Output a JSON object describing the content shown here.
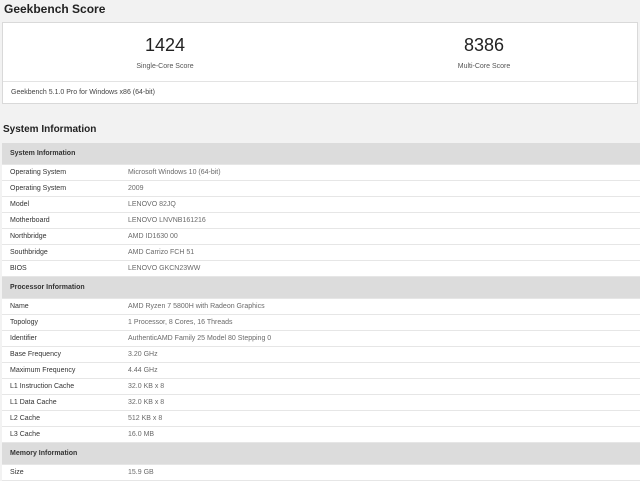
{
  "header": {
    "title": "Geekbench Score"
  },
  "scores": {
    "single": {
      "value": "1424",
      "label": "Single-Core Score"
    },
    "multi": {
      "value": "8386",
      "label": "Multi-Core Score"
    },
    "version": "Geekbench 5.1.0 Pro for Windows x86 (64-bit)"
  },
  "system_info": {
    "title": "System Information",
    "sections": [
      {
        "title": "System Information",
        "rows": [
          {
            "name": "Operating System",
            "value": "Microsoft Windows 10 (64-bit)"
          },
          {
            "name": "Operating System",
            "value": "2009"
          },
          {
            "name": "Model",
            "value": "LENOVO 82JQ"
          },
          {
            "name": "Motherboard",
            "value": "LENOVO LNVNB161216"
          },
          {
            "name": "Northbridge",
            "value": "AMD ID1630 00"
          },
          {
            "name": "Southbridge",
            "value": "AMD Carrizo FCH 51"
          },
          {
            "name": "BIOS",
            "value": "LENOVO GKCN23WW"
          }
        ]
      },
      {
        "title": "Processor Information",
        "rows": [
          {
            "name": "Name",
            "value": "AMD Ryzen 7 5800H with Radeon Graphics"
          },
          {
            "name": "Topology",
            "value": "1 Processor, 8 Cores, 16 Threads"
          },
          {
            "name": "Identifier",
            "value": "AuthenticAMD Family 25 Model 80 Stepping 0"
          },
          {
            "name": "Base Frequency",
            "value": "3.20 GHz"
          },
          {
            "name": "Maximum Frequency",
            "value": "4.44 GHz"
          },
          {
            "name": "L1 Instruction Cache",
            "value": "32.0 KB x 8"
          },
          {
            "name": "L1 Data Cache",
            "value": "32.0 KB x 8"
          },
          {
            "name": "L2 Cache",
            "value": "512 KB x 8"
          },
          {
            "name": "L3 Cache",
            "value": "16.0 MB"
          }
        ]
      },
      {
        "title": "Memory Information",
        "rows": [
          {
            "name": "Size",
            "value": "15.9 GB"
          }
        ]
      }
    ]
  }
}
